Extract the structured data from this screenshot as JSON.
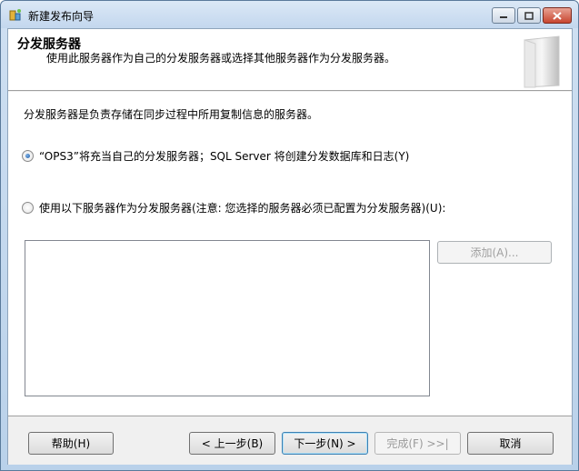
{
  "window": {
    "title": "新建发布向导"
  },
  "header": {
    "title": "分发服务器",
    "description": "使用此服务器作为自己的分发服务器或选择其他服务器作为分发服务器。"
  },
  "content": {
    "intro": "分发服务器是负责存储在同步过程中所用复制信息的服务器。",
    "option_self": "“OPS3”将充当自己的分发服务器；SQL Server 将创建分发数据库和日志(Y)",
    "option_other": "使用以下服务器作为分发服务器(注意: 您选择的服务器必须已配置为分发服务器)(U):",
    "add_label": "添加(A)..."
  },
  "footer": {
    "help": "帮助(H)",
    "back": "< 上一步(B)",
    "next": "下一步(N) >",
    "finish": "完成(F) >>|",
    "cancel": "取消"
  }
}
